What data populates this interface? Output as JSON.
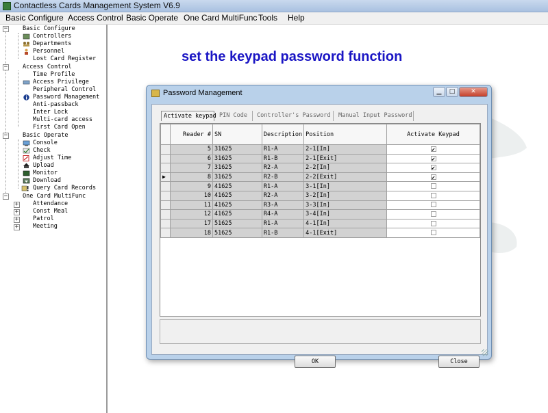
{
  "app": {
    "title": "Contactless Cards Management System  V6.9"
  },
  "menu": [
    "Basic Configure",
    "Access Control",
    "Basic Operate",
    "One Card MultiFunc",
    "Tools",
    "Help"
  ],
  "tree": {
    "basic_configure": {
      "label": "Basic Configure",
      "items": [
        "Controllers",
        "Departments",
        "Personnel",
        "Lost Card Register"
      ]
    },
    "access_control": {
      "label": "Access Control",
      "items": [
        "Time Profile",
        "Access Privilege",
        "Peripheral Control",
        "Password Management",
        "Anti-passback",
        "Inter Lock",
        "Multi-card access",
        "First Card Open"
      ]
    },
    "basic_operate": {
      "label": "Basic Operate",
      "items": [
        "Console",
        "Check",
        "Adjust Time",
        "Upload",
        "Monitor",
        "Download",
        "Query Card Records"
      ]
    },
    "one_card": {
      "label": "One Card MultiFunc",
      "items": [
        "Attendance",
        "Const Meal",
        "Patrol",
        "Meeting"
      ]
    }
  },
  "headline": "set the keypad password function",
  "dialog": {
    "title": "Password Management",
    "tabs": [
      "Activate keypad",
      "PIN Code",
      "Controller's Password",
      "Manual Input Password"
    ],
    "columns": [
      "Reader #",
      "SN",
      "Description",
      "Position",
      "Activate Keypad"
    ],
    "rows": [
      {
        "reader": "5",
        "sn": "31625",
        "desc": "R1-A",
        "pos": "2-1[In]",
        "active": true
      },
      {
        "reader": "6",
        "sn": "31625",
        "desc": "R1-B",
        "pos": "2-1[Exit]",
        "active": true
      },
      {
        "reader": "7",
        "sn": "31625",
        "desc": "R2-A",
        "pos": "2-2[In]",
        "active": true
      },
      {
        "reader": "8",
        "sn": "31625",
        "desc": "R2-B",
        "pos": "2-2[Exit]",
        "active": true
      },
      {
        "reader": "9",
        "sn": "41625",
        "desc": "R1-A",
        "pos": "3-1[In]",
        "active": false
      },
      {
        "reader": "10",
        "sn": "41625",
        "desc": "R2-A",
        "pos": "3-2[In]",
        "active": false
      },
      {
        "reader": "11",
        "sn": "41625",
        "desc": "R3-A",
        "pos": "3-3[In]",
        "active": false
      },
      {
        "reader": "12",
        "sn": "41625",
        "desc": "R4-A",
        "pos": "3-4[In]",
        "active": false
      },
      {
        "reader": "17",
        "sn": "51625",
        "desc": "R1-A",
        "pos": "4-1[In]",
        "active": false
      },
      {
        "reader": "18",
        "sn": "51625",
        "desc": "R1-B",
        "pos": "4-1[Exit]",
        "active": false
      }
    ],
    "current_row": 3,
    "ok_label": "OK",
    "close_label": "Close"
  },
  "colors": {
    "headline": "#1a15c4",
    "dialog_frame": "#b9d1ea",
    "grid_readonly": "#d2d2d2"
  }
}
